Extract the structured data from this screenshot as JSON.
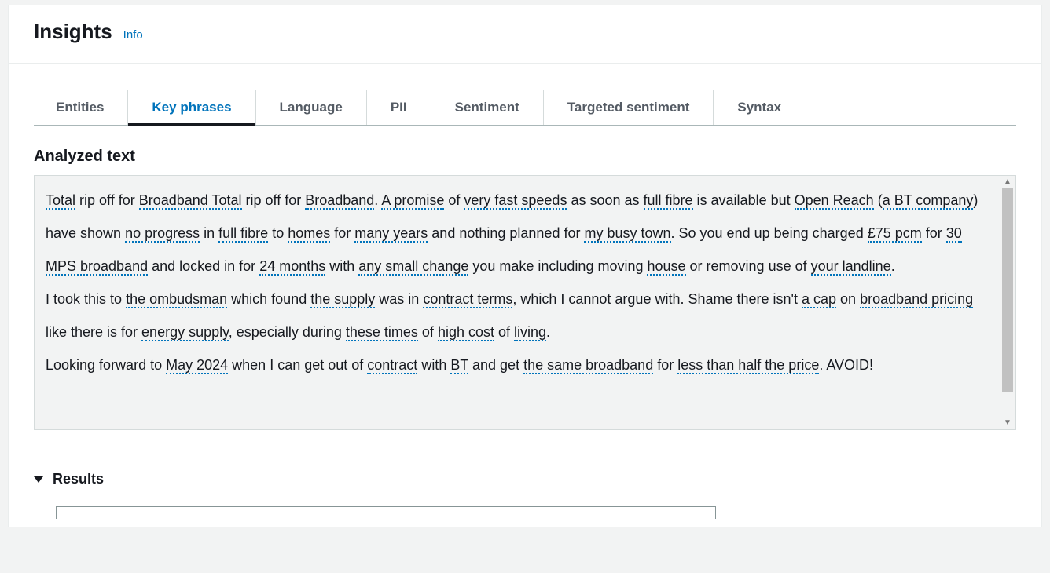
{
  "header": {
    "title": "Insights",
    "info_label": "Info"
  },
  "tabs": [
    {
      "label": "Entities",
      "active": false
    },
    {
      "label": "Key phrases",
      "active": true
    },
    {
      "label": "Language",
      "active": false
    },
    {
      "label": "PII",
      "active": false
    },
    {
      "label": "Sentiment",
      "active": false
    },
    {
      "label": "Targeted sentiment",
      "active": false
    },
    {
      "label": "Syntax",
      "active": false
    }
  ],
  "analyzed": {
    "heading": "Analyzed text",
    "tokens": [
      {
        "t": "Total",
        "kp": true
      },
      {
        "t": " rip off for ",
        "kp": false
      },
      {
        "t": "Broadband Total",
        "kp": true
      },
      {
        "t": " rip off for ",
        "kp": false
      },
      {
        "t": "Broadband",
        "kp": true
      },
      {
        "t": ". ",
        "kp": false
      },
      {
        "t": "A promise",
        "kp": true
      },
      {
        "t": " of ",
        "kp": false
      },
      {
        "t": "very fast speeds",
        "kp": true
      },
      {
        "t": " as soon as ",
        "kp": false
      },
      {
        "t": "full fibre",
        "kp": true
      },
      {
        "t": " is available but ",
        "kp": false
      },
      {
        "t": "Open Reach",
        "kp": true
      },
      {
        "t": " (",
        "kp": false
      },
      {
        "t": "a BT company",
        "kp": true
      },
      {
        "t": ") have shown ",
        "kp": false
      },
      {
        "t": "no progress",
        "kp": true
      },
      {
        "t": " in ",
        "kp": false
      },
      {
        "t": "full fibre",
        "kp": true
      },
      {
        "t": " to ",
        "kp": false
      },
      {
        "t": "homes",
        "kp": true
      },
      {
        "t": " for ",
        "kp": false
      },
      {
        "t": "many years",
        "kp": true
      },
      {
        "t": " and nothing planned for ",
        "kp": false
      },
      {
        "t": "my busy town",
        "kp": true
      },
      {
        "t": ". So you end up being charged ",
        "kp": false
      },
      {
        "t": "£75 pcm",
        "kp": true
      },
      {
        "t": " for ",
        "kp": false
      },
      {
        "t": "30 MPS broadband",
        "kp": true
      },
      {
        "t": " and locked in for ",
        "kp": false
      },
      {
        "t": "24 months",
        "kp": true
      },
      {
        "t": " with ",
        "kp": false
      },
      {
        "t": "any small change",
        "kp": true
      },
      {
        "t": " you make including moving ",
        "kp": false
      },
      {
        "t": "house",
        "kp": true
      },
      {
        "t": " or removing use of ",
        "kp": false
      },
      {
        "t": "your landline",
        "kp": true
      },
      {
        "t": ".",
        "kp": false
      },
      {
        "t": "\n",
        "kp": false
      },
      {
        "t": "I took this to ",
        "kp": false
      },
      {
        "t": "the ombudsman",
        "kp": true
      },
      {
        "t": " which found ",
        "kp": false
      },
      {
        "t": "the supply",
        "kp": true
      },
      {
        "t": " was in ",
        "kp": false
      },
      {
        "t": "contract terms",
        "kp": true
      },
      {
        "t": ", which I cannot argue with. Shame there isn't ",
        "kp": false
      },
      {
        "t": "a cap",
        "kp": true
      },
      {
        "t": " on ",
        "kp": false
      },
      {
        "t": "broadband pricing",
        "kp": true
      },
      {
        "t": " like there is for ",
        "kp": false
      },
      {
        "t": "energy supply",
        "kp": true
      },
      {
        "t": ", especially during ",
        "kp": false
      },
      {
        "t": "these times",
        "kp": true
      },
      {
        "t": " of ",
        "kp": false
      },
      {
        "t": "high cost",
        "kp": true
      },
      {
        "t": " of ",
        "kp": false
      },
      {
        "t": "living",
        "kp": true
      },
      {
        "t": ".",
        "kp": false
      },
      {
        "t": "\n",
        "kp": false
      },
      {
        "t": "Looking forward to ",
        "kp": false
      },
      {
        "t": "May 2024",
        "kp": true
      },
      {
        "t": " when I can get out of ",
        "kp": false
      },
      {
        "t": "contract",
        "kp": true
      },
      {
        "t": " with ",
        "kp": false
      },
      {
        "t": "BT",
        "kp": true
      },
      {
        "t": " and get ",
        "kp": false
      },
      {
        "t": "the same broadband",
        "kp": true
      },
      {
        "t": " for ",
        "kp": false
      },
      {
        "t": "less than half the price",
        "kp": true
      },
      {
        "t": ". AVOID!",
        "kp": false
      }
    ]
  },
  "results": {
    "heading": "Results"
  }
}
